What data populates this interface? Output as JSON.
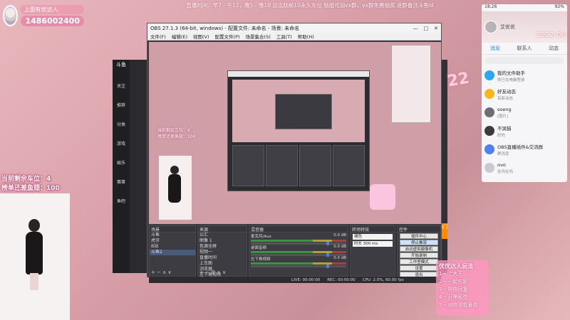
{
  "overlay": {
    "streamer_name": "上面有优达人",
    "room_id": "1486002400",
    "banner": "直播时间：早7 - 午12，晚5 - 晚10 总活跃前10永久车位 贴纸可加vx群，vx群免费抽奖 进群备注斗鱼id",
    "parking_left": "当前剩余车位：4",
    "fish_balls_needed": "榜单还差鱼翅：100",
    "deco_number": "22"
  },
  "hint_box": {
    "title": "优优达人玩法",
    "rows": [
      "1~ 上大王",
      "2~ 一起吃饭",
      "3~ 帮你回复",
      "4~ 开黑私信",
      "5~ 对你说我爱你"
    ]
  },
  "douyu": {
    "logo": "斗鱼",
    "nav": [
      "关注",
      "推荐",
      "分类",
      "游戏",
      "娱乐",
      "赛事",
      "鱼吧"
    ],
    "tag": "热门"
  },
  "obs": {
    "title": "OBS 27.1.3 (64-bit, windows) - 配置文件: 未命名 - 场景: 未命名",
    "menu": [
      "文件(F)",
      "编辑(E)",
      "视图(V)",
      "配置文件(P)",
      "场景集合(S)",
      "工具(T)",
      "帮助(H)"
    ],
    "preview": {
      "overlay_line1": "当前剩余车位：4",
      "overlay_line2": "榜单还差鱼翅：100"
    },
    "sourcebar": "未选择源",
    "docks": {
      "scenes_title": "场景",
      "scenes": [
        "斗鱼",
        "虎牙",
        "B站",
        "斗鱼2"
      ],
      "sources_title": "来源",
      "sources": [
        "公汇",
        "图像 1",
        "色源全屏",
        "视频一",
        "直播时间",
        "上车图",
        "浏览器",
        "左下角视频"
      ],
      "mixer_title": "混音器",
      "mixer": [
        {
          "name": "麦克风/Aux",
          "db": "0.0 dB"
        },
        {
          "name": "桌面音频",
          "db": "0.0 dB"
        },
        {
          "name": "左下角视频",
          "db": "0.0 dB"
        }
      ],
      "transitions_title": "转场特效",
      "transition_value": "褪色",
      "duration": "时长 300 ms",
      "controls_title": "控件",
      "controls": [
        "插件中心",
        "停止推流",
        "启动虚拟摄像机",
        "开始录制",
        "工作室模式",
        "设置",
        "退出"
      ]
    },
    "status": {
      "live": "LIVE: 00:00:00",
      "rec": "REC: 00:00:00",
      "cpu": "CPU: 2.0%, 60.00 fps"
    }
  },
  "phone": {
    "status_left": "18:26",
    "status_right": "92%",
    "username": "艾优优",
    "date": "2022-06",
    "tabs": [
      "消息",
      "联系人",
      "动态"
    ],
    "active_tab": 0,
    "chats": [
      {
        "name": "我的文件助手",
        "sub": "你已在电脑登录",
        "color": "#2ea6f2"
      },
      {
        "name": "好友动态",
        "sub": "有新动态",
        "color": "#f6b71f"
      },
      {
        "name": "soeng",
        "sub": "[图片]",
        "color": "#6d6d74"
      },
      {
        "name": "不哭猫",
        "sub": "好的",
        "color": "#3a3a3f"
      },
      {
        "name": "OBS直播插件&交流群",
        "sub": "群消息",
        "color": "#4f7ff5"
      },
      {
        "name": "ovo",
        "sub": "在吗在吗",
        "color": "#c9c9cf"
      }
    ]
  }
}
